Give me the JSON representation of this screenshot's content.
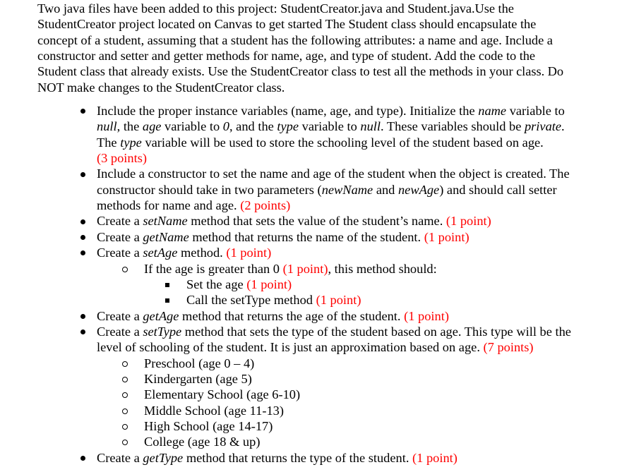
{
  "intro": {
    "lines": [
      "Two java files have been added to this project: StudentCreator.java and Student.java.Use the",
      "StudentCreator project located on Canvas to get started The Student class should encapsulate the",
      "concept of a student, assuming that a student has the following attributes: a name and age. Include a",
      "constructor and setter and getter methods for name, age, and type of student. Add the code to the",
      "Student class that already exists. Use the StudentCreator class to test all the methods in your class. Do",
      "NOT make changes to the StudentCreator class."
    ]
  },
  "accent_color": "#ff0000",
  "requirements": {
    "instance_vars": {
      "l1a": "Include the proper instance variables (name, age, and type). Initialize the ",
      "l1_name": "name",
      "l1b": " variable to",
      "l2_null1": "null",
      "l2a": ", the ",
      "l2_age": "age",
      "l2b": " variable to ",
      "l2_zero": "0",
      "l2c": ", and the ",
      "l2_type": "type",
      "l2d": " variable to ",
      "l2_null2": "null",
      "l2e": ". These variables should be ",
      "l2_private": "private",
      "l2f": ".",
      "l3a": "The ",
      "l3_type": "type",
      "l3b": " variable will be used to store the schooling level of the student based on age.",
      "points": "(3 points)"
    },
    "constructor": {
      "l1": "Include a constructor to set the name and age of the student when the object is created. The",
      "l2a": "constructor should take in two parameters (",
      "l2_newName": "newName",
      "l2b": " and ",
      "l2_newAge": "newAge",
      "l2c": ") and should call setter",
      "l3": "methods for name and age. ",
      "points": "(2 points)"
    },
    "setName": {
      "prefix": "Create a ",
      "method": "setName",
      "suffix": " method that sets the value of the student’s name. ",
      "points": "(1 point)"
    },
    "getName": {
      "prefix": "Create a ",
      "method": "getName",
      "suffix": " method that returns the name of the student. ",
      "points": "(1 point)"
    },
    "setAge": {
      "prefix": "Create a ",
      "method": "setAge",
      "suffix": " method. ",
      "points": "(1 point)",
      "condition": {
        "prefix": "If the age is greater than 0 ",
        "points": "(1 point)",
        "suffix": ", this method should:",
        "steps": [
          {
            "text": "Set the age ",
            "points": "(1 point)"
          },
          {
            "text": "Call the setType method ",
            "points": "(1 point)"
          }
        ]
      }
    },
    "getAge": {
      "prefix": "Create a ",
      "method": "getAge",
      "suffix": " method that returns the age of the student. ",
      "points": "(1 point)"
    },
    "setType": {
      "prefix": "Create a ",
      "method": "setType",
      "l1_suffix": " method that sets the type of the student based on age. This type will be the",
      "l2": "level of schooling of the student. It is just an approximation based on age. ",
      "points": "(7 points)",
      "levels": [
        "Preschool (age 0 – 4)",
        "Kindergarten (age 5)",
        "Elementary School (age 6-10)",
        "Middle School (age 11-13)",
        "High School (age 14-17)",
        "College (age 18 & up)"
      ]
    },
    "getType": {
      "prefix": "Create a ",
      "method": "getType",
      "suffix": " method that returns the type of the student. ",
      "points": "(1 point)"
    }
  }
}
